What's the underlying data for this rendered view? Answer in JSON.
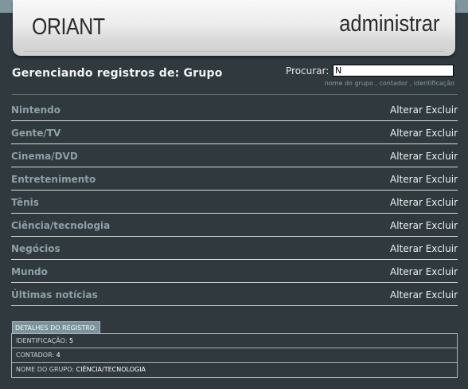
{
  "header": {
    "logo": "ORIANT",
    "admin_label": "administrar"
  },
  "title": "Gerenciando registros de: Grupo",
  "search": {
    "label": "Procurar:",
    "value": "N",
    "hint": "nome do grupo , contador , identificação"
  },
  "records": [
    {
      "name": "Nintendo"
    },
    {
      "name": "Gente/TV"
    },
    {
      "name": "Cinema/DVD"
    },
    {
      "name": "Entretenimento"
    },
    {
      "name": "Tênis"
    },
    {
      "name": "Ciência/tecnologia"
    },
    {
      "name": "Negócios"
    },
    {
      "name": "Mundo"
    },
    {
      "name": "Últimas notícias"
    }
  ],
  "actions": {
    "edit": "Alterar",
    "delete": "Excluir"
  },
  "details": {
    "tab": "DETALHES DO REGISTRO:",
    "rows": [
      {
        "label": "IDENTIFICAÇÃO:",
        "value": "5"
      },
      {
        "label": "CONTADOR:",
        "value": "4"
      },
      {
        "label": "NOME DO GRUPO:",
        "value": "CIÊNCIA/TECNOLOGIA"
      }
    ]
  },
  "colors": {
    "background": "#2f393e",
    "strip": "#7f969f",
    "item_text": "#8fa1a8"
  }
}
